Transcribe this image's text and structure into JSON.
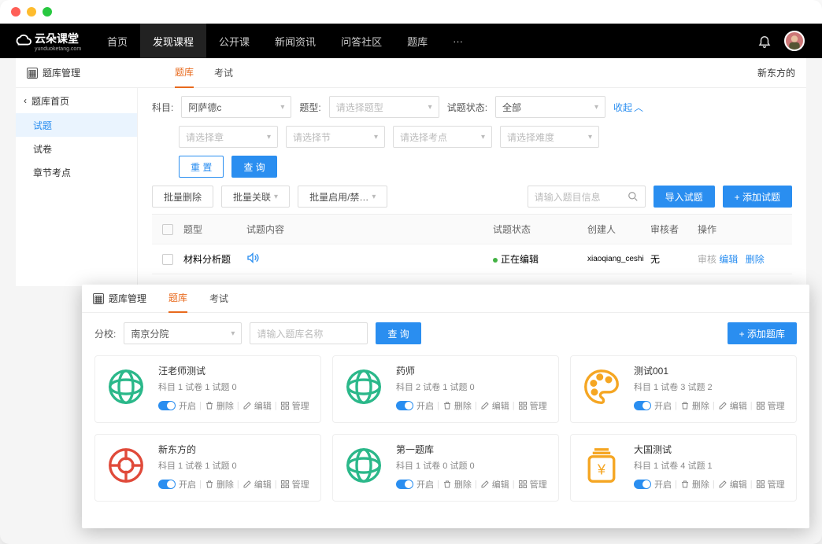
{
  "logo_text": "云朵课堂",
  "logo_sub": "yunduoketang.com",
  "nav": [
    "首页",
    "发现课程",
    "公开课",
    "新闻资讯",
    "问答社区",
    "题库",
    "···"
  ],
  "nav_active": 1,
  "window1": {
    "title": "题库管理",
    "tabs": [
      "题库",
      "考试"
    ],
    "right_label": "新东方的",
    "sidebar_back": "题库首页",
    "sidebar_items": [
      "试题",
      "试卷",
      "章节考点"
    ],
    "filters": {
      "subject_label": "科目:",
      "subject_value": "阿萨德c",
      "type_label": "题型:",
      "type_ph": "请选择题型",
      "status_label": "试题状态:",
      "status_value": "全部",
      "collapse": "收起",
      "chapter_ph": "请选择章",
      "section_ph": "请选择节",
      "point_ph": "请选择考点",
      "difficulty_ph": "请选择难度",
      "reset_btn": "重 置",
      "query_btn": "查 询"
    },
    "toolbar": {
      "batch_delete": "批量删除",
      "batch_relate": "批量关联",
      "batch_enable": "批量启用/禁…",
      "search_ph": "请输入题目信息",
      "import_btn": "导入试题",
      "add_btn": "+ 添加试题"
    },
    "table": {
      "headers": [
        "题型",
        "试题内容",
        "试题状态",
        "创建人",
        "审核者",
        "操作"
      ],
      "row": {
        "type": "材料分析题",
        "status": "正在编辑",
        "creator": "xiaoqiang_ceshi",
        "reviewer": "无",
        "op_review": "审核",
        "op_edit": "编辑",
        "op_delete": "删除"
      }
    }
  },
  "window2": {
    "title": "题库管理",
    "tabs": [
      "题库",
      "考试"
    ],
    "branch_label": "分校:",
    "branch_value": "南京分院",
    "name_ph": "请输入题库名称",
    "query_btn": "查 询",
    "add_btn": "+ 添加题库",
    "ops": {
      "on": "开启",
      "delete": "删除",
      "edit": "编辑",
      "manage": "管理"
    },
    "cards": [
      {
        "title": "汪老师测试",
        "meta": "科目 1  试卷 1  试题 0",
        "icon": "globe-green"
      },
      {
        "title": "药师",
        "meta": "科目 2  试卷 1  试题 0",
        "icon": "globe-green"
      },
      {
        "title": "测试001",
        "meta": "科目 1  试卷 3  试题 2",
        "icon": "palette-orange"
      },
      {
        "title": "新东方的",
        "meta": "科目 1  试卷 1  试题 0",
        "icon": "coin-red"
      },
      {
        "title": "第一题库",
        "meta": "科目 1  试卷 0  试题 0",
        "icon": "globe-green"
      },
      {
        "title": "大国测试",
        "meta": "科目 1  试卷 4  试题 1",
        "icon": "jar-orange"
      }
    ]
  }
}
